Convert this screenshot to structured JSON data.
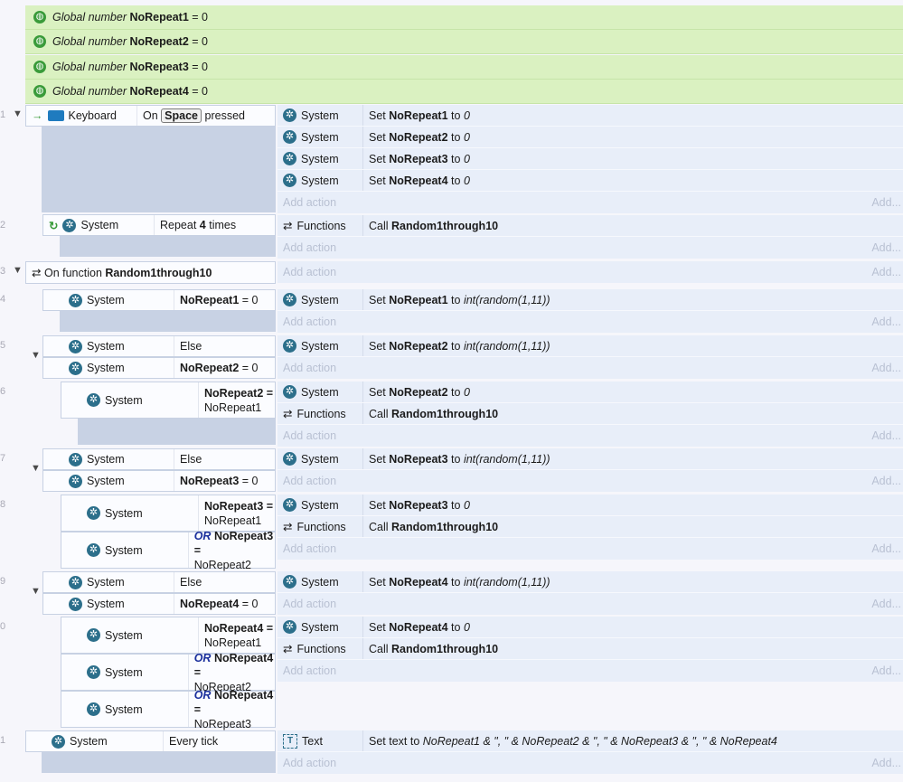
{
  "globals": [
    {
      "prefix": "Global number",
      "name": "NoRepeat1",
      "value": "= 0"
    },
    {
      "prefix": "Global number",
      "name": "NoRepeat2",
      "value": "= 0"
    },
    {
      "prefix": "Global number",
      "name": "NoRepeat3",
      "value": "= 0"
    },
    {
      "prefix": "Global number",
      "name": "NoRepeat4",
      "value": "= 0"
    }
  ],
  "line_numbers": [
    "1",
    "2",
    "3",
    "4",
    "5",
    "6",
    "7",
    "8",
    "9",
    "0",
    "1"
  ],
  "common": {
    "system": "System",
    "functions": "Functions",
    "text_obj": "Text",
    "add_action": "Add action",
    "add": "Add...",
    "else": "Else",
    "or": "OR",
    "set": "Set",
    "to": "to",
    "call": "Call"
  },
  "ev1": {
    "object": "Keyboard",
    "on": "On",
    "key": "Space",
    "pressed": "pressed",
    "actions": [
      {
        "var": "NoRepeat1",
        "val": "0"
      },
      {
        "var": "NoRepeat2",
        "val": "0"
      },
      {
        "var": "NoRepeat3",
        "val": "0"
      },
      {
        "var": "NoRepeat4",
        "val": "0"
      }
    ]
  },
  "ev2": {
    "repeat": "Repeat",
    "count": "4",
    "times": "times",
    "fn": "Random1through10"
  },
  "ev3": {
    "on_function": "On function",
    "fn": "Random1through10"
  },
  "ev4": {
    "cond_var": "NoRepeat1",
    "cond_op": "= 0",
    "act_var": "NoRepeat1",
    "expr": "int(random(1,11))"
  },
  "ev5": {
    "cond_var": "NoRepeat2",
    "cond_op": "= 0",
    "act_var": "NoRepeat2",
    "expr": "int(random(1,11))"
  },
  "ev6": {
    "c1": "NoRepeat2 =",
    "c1b": "NoRepeat1",
    "act_var": "NoRepeat2",
    "val": "0",
    "fn": "Random1through10"
  },
  "ev7": {
    "cond_var": "NoRepeat3",
    "cond_op": "= 0",
    "act_var": "NoRepeat3",
    "expr": "int(random(1,11))"
  },
  "ev8": {
    "c1": "NoRepeat3 =",
    "c1b": "NoRepeat1",
    "c2": "NoRepeat3 =",
    "c2b": "NoRepeat2",
    "act_var": "NoRepeat3",
    "val": "0",
    "fn": "Random1through10"
  },
  "ev9": {
    "cond_var": "NoRepeat4",
    "cond_op": "= 0",
    "act_var": "NoRepeat4",
    "expr": "int(random(1,11))"
  },
  "ev10": {
    "c1": "NoRepeat4 =",
    "c1b": "NoRepeat1",
    "c2": "NoRepeat4 =",
    "c2b": "NoRepeat2",
    "c3": "NoRepeat4 =",
    "c3b": "NoRepeat3",
    "act_var": "NoRepeat4",
    "val": "0",
    "fn": "Random1through10"
  },
  "ev11": {
    "cond": "Every tick",
    "set_text": "Set text to",
    "expr": "NoRepeat1 & \", \" & NoRepeat2 & \", \" & NoRepeat3 & \", \" & NoRepeat4"
  }
}
